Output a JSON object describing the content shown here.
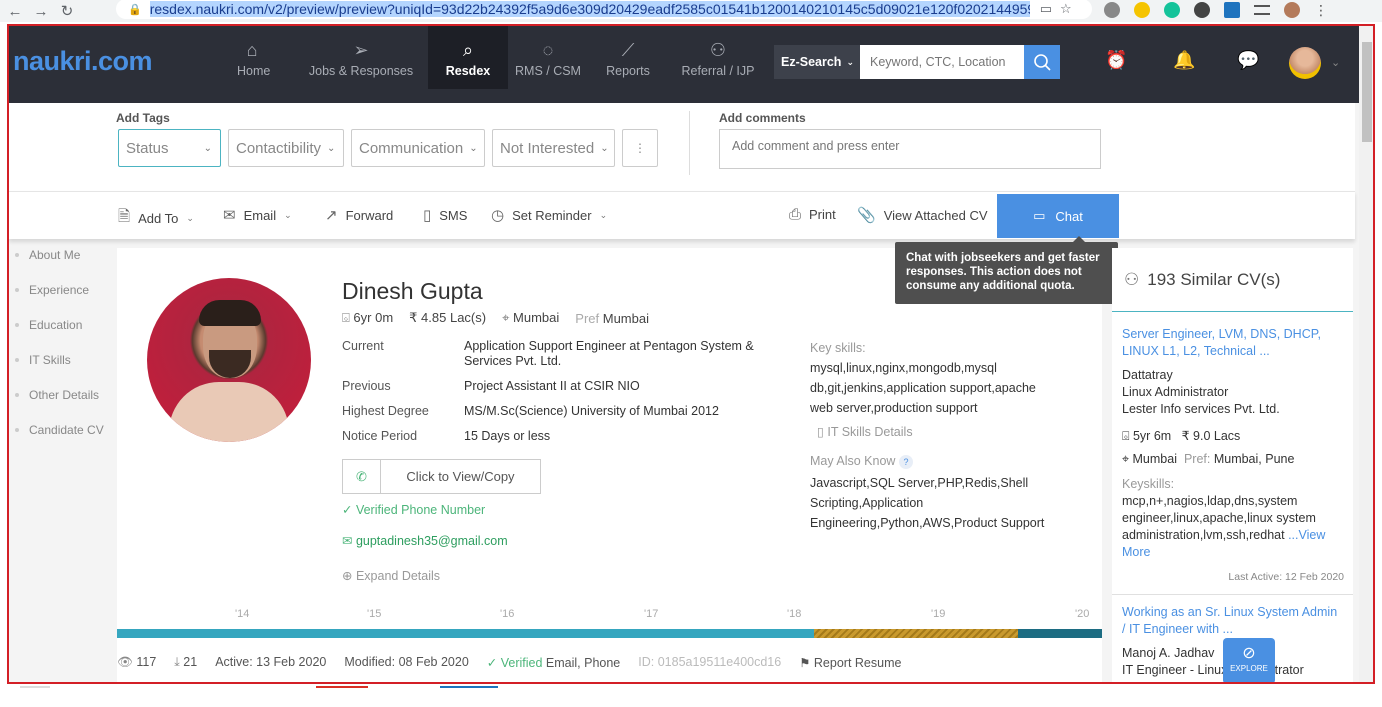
{
  "browser": {
    "url": "resdex.naukri.com/v2/preview/preview?uniqId=93d22b24392f5a9d6e309d20429eadf2585c01541b1200140210145c5d09021e120f0202144959"
  },
  "nav": {
    "logo": "naukri.com",
    "items": [
      {
        "label": "Home",
        "icon": "home-icon"
      },
      {
        "label": "Jobs & Responses",
        "icon": "send-icon"
      },
      {
        "label": "Resdex",
        "icon": "search-icon"
      },
      {
        "label": "RMS / CSM",
        "icon": "rms-icon"
      },
      {
        "label": "Reports",
        "icon": "chart-icon"
      },
      {
        "label": "Referral / IJP",
        "icon": "users-icon"
      }
    ],
    "ez_search": "Ez-Search",
    "search_placeholder": "Keyword, CTC, Location"
  },
  "tags": {
    "title": "Add Tags",
    "dropdowns": [
      "Status",
      "Contactibility",
      "Communication",
      "Not Interested"
    ],
    "comment_title": "Add comments",
    "comment_placeholder": "Add comment and press enter"
  },
  "actions": {
    "add_to": "Add To",
    "email": "Email",
    "forward": "Forward",
    "sms": "SMS",
    "reminder": "Set Reminder",
    "print": "Print",
    "view_cv": "View Attached CV",
    "chat": "Chat"
  },
  "tooltip": "Chat with jobseekers and get faster responses. This action does not consume any additional quota.",
  "sidebar": [
    "About Me",
    "Experience",
    "Education",
    "IT Skills",
    "Other Details",
    "Candidate CV"
  ],
  "profile": {
    "name": "Dinesh Gupta",
    "experience": "6yr 0m",
    "ctc": "4.85 Lac(s)",
    "location": "Mumbai",
    "pref_label": "Pref",
    "pref": "Mumbai",
    "details": [
      {
        "label": "Current",
        "value": "Application Support Engineer at Pentagon System & Services Pvt. Ltd."
      },
      {
        "label": "Previous",
        "value": "Project Assistant II at CSIR NIO"
      },
      {
        "label": "Highest Degree",
        "value": "MS/M.Sc(Science) University of Mumbai 2012"
      },
      {
        "label": "Notice Period",
        "value": "15 Days or less"
      }
    ],
    "phone_cta": "Click to View/Copy",
    "verified_phone": "Verified Phone Number",
    "email": "guptadinesh35@gmail.com",
    "expand": "Expand Details",
    "key_skills_label": "Key skills:",
    "key_skills": "mysql,linux,nginx,mongodb,mysql db,git,jenkins,application support,apache web server,production support",
    "it_skills": "IT Skills Details",
    "may_know_label": "May Also Know",
    "may_know": "Javascript,SQL Server,PHP,Redis,Shell Scripting,Application Engineering,Python,AWS,Product Support",
    "timeline_ticks": [
      "'14",
      "'15",
      "'16",
      "'17",
      "'18",
      "'19",
      "'20"
    ],
    "stats": {
      "views": "117",
      "downloads": "21",
      "active": "Active: 13 Feb 2020",
      "modified": "Modified: 08 Feb 2020",
      "verified_word": "Verified",
      "verified_items": "Email, Phone",
      "id": "ID: 0185a19511e400cd16",
      "report": "Report Resume"
    }
  },
  "similar": {
    "title": "193 Similar CV(s)",
    "cards": [
      {
        "headline": "Server Engineer, LVM, DNS, DHCP, LINUX L1, L2, Technical ...",
        "name": "Dattatray",
        "role": "Linux Administrator",
        "company": "Lester Info services Pvt. Ltd.",
        "exp": "5yr 6m",
        "ctc": "9.0 Lacs",
        "loc": "Mumbai",
        "pref_label": "Pref:",
        "pref": "Mumbai, Pune",
        "keyskills_label": "Keyskills:",
        "keyskills": "mcp,n+,nagios,ldap,dns,system engineer,linux,apache,linux system administration,lvm,ssh,redhat",
        "view_more": "...View More",
        "last_active": "Last Active: 12 Feb 2020"
      },
      {
        "headline": "Working as an Sr. Linux System Admin / IT Engineer with ...",
        "name": "Manoj A. Jadhav",
        "role": "IT Engineer - Linux Administrator"
      }
    ]
  },
  "explore": "EXPLORE",
  "colors": {
    "nav_bg": "#2c2f38",
    "accent": "#4a90e2",
    "teal": "#4cb4c2",
    "green": "#4cb57a",
    "frame_border": "#d31f26"
  }
}
